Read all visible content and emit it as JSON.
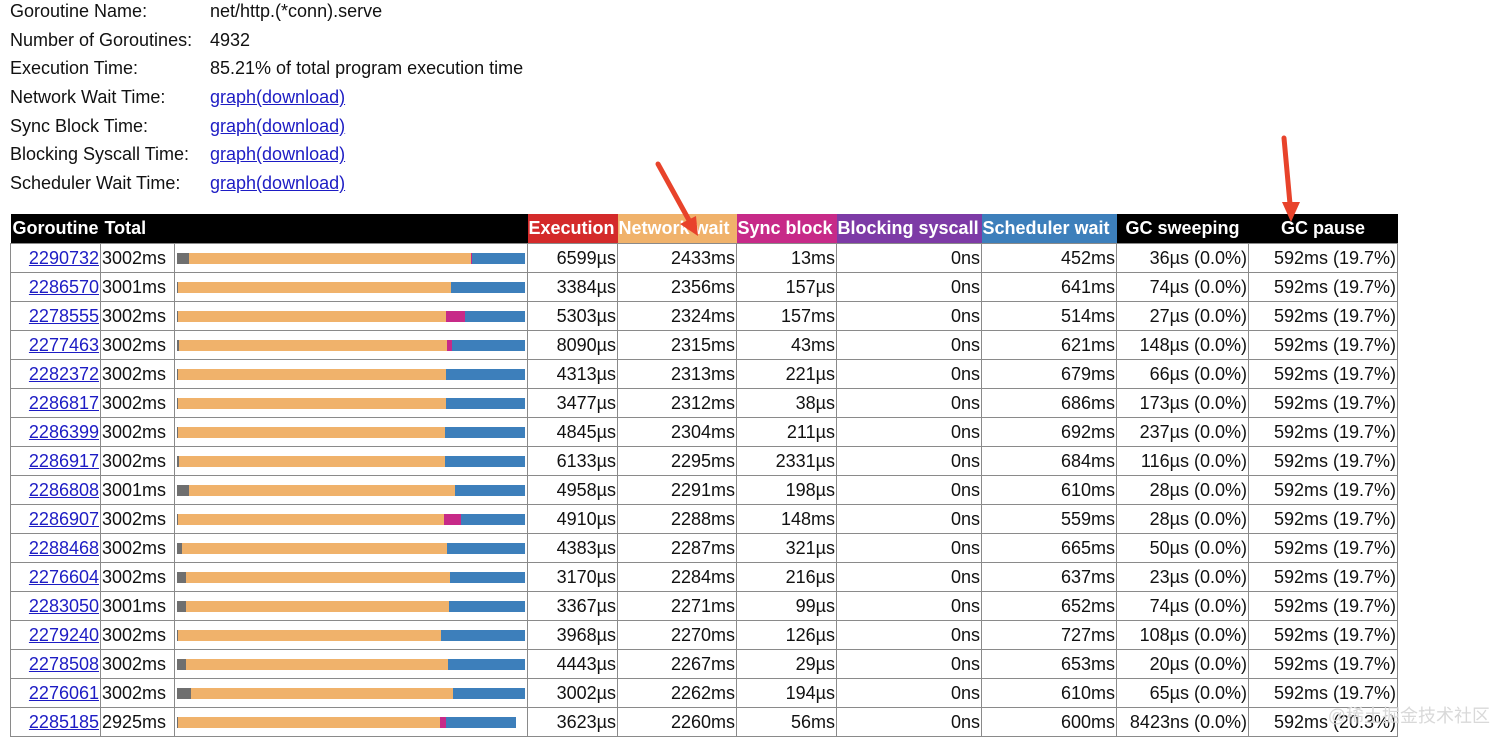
{
  "summary": {
    "goroutine_name_label": "Goroutine Name:",
    "goroutine_name_value": "net/http.(*conn).serve",
    "num_goroutines_label": "Number of Goroutines:",
    "num_goroutines_value": "4932",
    "execution_time_label": "Execution Time:",
    "execution_time_value": "85.21% of total program execution time",
    "network_wait_label": "Network Wait Time:",
    "sync_block_label": "Sync Block Time:",
    "blocking_syscall_label": "Blocking Syscall Time:",
    "scheduler_wait_label": "Scheduler Wait Time:",
    "graph_link_text": "graph",
    "download_link_text": "(download)"
  },
  "table": {
    "headers": {
      "goroutine": "Goroutine",
      "total": "Total",
      "execution": "Execution",
      "network_wait": "Network wait",
      "sync_block": "Sync block",
      "blocking_syscall": "Blocking syscall",
      "scheduler_wait": "Scheduler wait",
      "gc_sweeping": "GC sweeping",
      "gc_pause": "GC pause"
    },
    "colors": {
      "execution": "#d42a2a",
      "execution_bar": "#6f6f6f",
      "network_wait": "#f0b26b",
      "sync_block": "#c72a88",
      "blocking_syscall": "#7d3ba6",
      "scheduler_wait": "#3d7fbb",
      "link": "#1d1cc4"
    },
    "rows": [
      {
        "id": "2290732",
        "total": "3002ms",
        "execution": "6599µs",
        "network_wait": "2433ms",
        "sync_block": "13ms",
        "blocking_syscall": "0ns",
        "scheduler_wait": "452ms",
        "gc_sweeping": "36µs (0.0%)",
        "gc_pause": "592ms (19.7%)",
        "bar": {
          "exec": 0.035,
          "net": 0.81,
          "sync": 0.004,
          "sched": 0.151
        }
      },
      {
        "id": "2286570",
        "total": "3001ms",
        "execution": "3384µs",
        "network_wait": "2356ms",
        "sync_block": "157µs",
        "blocking_syscall": "0ns",
        "scheduler_wait": "641ms",
        "gc_sweeping": "74µs (0.0%)",
        "gc_pause": "592ms (19.7%)",
        "bar": {
          "exec": 0.004,
          "net": 0.782,
          "sync": 0.0,
          "sched": 0.214
        }
      },
      {
        "id": "2278555",
        "total": "3002ms",
        "execution": "5303µs",
        "network_wait": "2324ms",
        "sync_block": "157ms",
        "blocking_syscall": "0ns",
        "scheduler_wait": "514ms",
        "gc_sweeping": "27µs (0.0%)",
        "gc_pause": "592ms (19.7%)",
        "bar": {
          "exec": 0.004,
          "net": 0.77,
          "sync": 0.055,
          "sched": 0.171
        }
      },
      {
        "id": "2277463",
        "total": "3002ms",
        "execution": "8090µs",
        "network_wait": "2315ms",
        "sync_block": "43ms",
        "blocking_syscall": "0ns",
        "scheduler_wait": "621ms",
        "gc_sweeping": "148µs (0.0%)",
        "gc_pause": "592ms (19.7%)",
        "bar": {
          "exec": 0.005,
          "net": 0.77,
          "sync": 0.014,
          "sched": 0.211
        }
      },
      {
        "id": "2282372",
        "total": "3002ms",
        "execution": "4313µs",
        "network_wait": "2313ms",
        "sync_block": "221µs",
        "blocking_syscall": "0ns",
        "scheduler_wait": "679ms",
        "gc_sweeping": "66µs (0.0%)",
        "gc_pause": "592ms (19.7%)",
        "bar": {
          "exec": 0.004,
          "net": 0.77,
          "sync": 0.0,
          "sched": 0.226
        }
      },
      {
        "id": "2286817",
        "total": "3002ms",
        "execution": "3477µs",
        "network_wait": "2312ms",
        "sync_block": "38µs",
        "blocking_syscall": "0ns",
        "scheduler_wait": "686ms",
        "gc_sweeping": "173µs (0.0%)",
        "gc_pause": "592ms (19.7%)",
        "bar": {
          "exec": 0.003,
          "net": 0.77,
          "sync": 0.0,
          "sched": 0.227
        }
      },
      {
        "id": "2286399",
        "total": "3002ms",
        "execution": "4845µs",
        "network_wait": "2304ms",
        "sync_block": "211µs",
        "blocking_syscall": "0ns",
        "scheduler_wait": "692ms",
        "gc_sweeping": "237µs (0.0%)",
        "gc_pause": "592ms (19.7%)",
        "bar": {
          "exec": 0.003,
          "net": 0.767,
          "sync": 0.0,
          "sched": 0.23
        }
      },
      {
        "id": "2286917",
        "total": "3002ms",
        "execution": "6133µs",
        "network_wait": "2295ms",
        "sync_block": "2331µs",
        "blocking_syscall": "0ns",
        "scheduler_wait": "684ms",
        "gc_sweeping": "116µs (0.0%)",
        "gc_pause": "592ms (19.7%)",
        "bar": {
          "exec": 0.005,
          "net": 0.765,
          "sync": 0.0,
          "sched": 0.23
        }
      },
      {
        "id": "2286808",
        "total": "3001ms",
        "execution": "4958µs",
        "network_wait": "2291ms",
        "sync_block": "198µs",
        "blocking_syscall": "0ns",
        "scheduler_wait": "610ms",
        "gc_sweeping": "28µs (0.0%)",
        "gc_pause": "592ms (19.7%)",
        "bar": {
          "exec": 0.035,
          "net": 0.765,
          "sync": 0.0,
          "sched": 0.2
        }
      },
      {
        "id": "2286907",
        "total": "3002ms",
        "execution": "4910µs",
        "network_wait": "2288ms",
        "sync_block": "148ms",
        "blocking_syscall": "0ns",
        "scheduler_wait": "559ms",
        "gc_sweeping": "28µs (0.0%)",
        "gc_pause": "592ms (19.7%)",
        "bar": {
          "exec": 0.004,
          "net": 0.762,
          "sync": 0.05,
          "sched": 0.184
        }
      },
      {
        "id": "2288468",
        "total": "3002ms",
        "execution": "4383µs",
        "network_wait": "2287ms",
        "sync_block": "321µs",
        "blocking_syscall": "0ns",
        "scheduler_wait": "665ms",
        "gc_sweeping": "50µs (0.0%)",
        "gc_pause": "592ms (19.7%)",
        "bar": {
          "exec": 0.015,
          "net": 0.76,
          "sync": 0.0,
          "sched": 0.225
        }
      },
      {
        "id": "2276604",
        "total": "3002ms",
        "execution": "3170µs",
        "network_wait": "2284ms",
        "sync_block": "216µs",
        "blocking_syscall": "0ns",
        "scheduler_wait": "637ms",
        "gc_sweeping": "23µs (0.0%)",
        "gc_pause": "592ms (19.7%)",
        "bar": {
          "exec": 0.025,
          "net": 0.76,
          "sync": 0.0,
          "sched": 0.215
        }
      },
      {
        "id": "2283050",
        "total": "3001ms",
        "execution": "3367µs",
        "network_wait": "2271ms",
        "sync_block": "99µs",
        "blocking_syscall": "0ns",
        "scheduler_wait": "652ms",
        "gc_sweeping": "74µs (0.0%)",
        "gc_pause": "592ms (19.7%)",
        "bar": {
          "exec": 0.025,
          "net": 0.757,
          "sync": 0.0,
          "sched": 0.218
        }
      },
      {
        "id": "2279240",
        "total": "3002ms",
        "execution": "3968µs",
        "network_wait": "2270ms",
        "sync_block": "126µs",
        "blocking_syscall": "0ns",
        "scheduler_wait": "727ms",
        "gc_sweeping": "108µs (0.0%)",
        "gc_pause": "592ms (19.7%)",
        "bar": {
          "exec": 0.004,
          "net": 0.756,
          "sync": 0.0,
          "sched": 0.24
        }
      },
      {
        "id": "2278508",
        "total": "3002ms",
        "execution": "4443µs",
        "network_wait": "2267ms",
        "sync_block": "29µs",
        "blocking_syscall": "0ns",
        "scheduler_wait": "653ms",
        "gc_sweeping": "20µs (0.0%)",
        "gc_pause": "592ms (19.7%)",
        "bar": {
          "exec": 0.025,
          "net": 0.755,
          "sync": 0.0,
          "sched": 0.22
        }
      },
      {
        "id": "2276061",
        "total": "3002ms",
        "execution": "3002µs",
        "network_wait": "2262ms",
        "sync_block": "194µs",
        "blocking_syscall": "0ns",
        "scheduler_wait": "610ms",
        "gc_sweeping": "65µs (0.0%)",
        "gc_pause": "592ms (19.7%)",
        "bar": {
          "exec": 0.04,
          "net": 0.753,
          "sync": 0.0,
          "sched": 0.207
        }
      },
      {
        "id": "2285185",
        "total": "2925ms",
        "execution": "3623µs",
        "network_wait": "2260ms",
        "sync_block": "56ms",
        "blocking_syscall": "0ns",
        "scheduler_wait": "600ms",
        "gc_sweeping": "8423ns (0.0%)",
        "gc_pause": "592ms (20.3%)",
        "bar": {
          "exec": 0.004,
          "net": 0.75,
          "sync": 0.018,
          "sched": 0.2
        }
      }
    ]
  },
  "watermark": "@稀土掘金技术社区"
}
